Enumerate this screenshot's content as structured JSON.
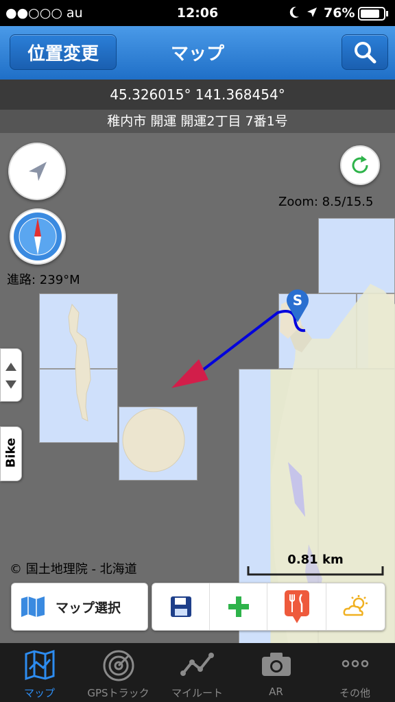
{
  "status_bar": {
    "carrier": "●●○○○ au",
    "time": "12:06",
    "battery": "76%"
  },
  "nav": {
    "left_button": "位置変更",
    "title": "マップ"
  },
  "info": {
    "coordinates": "45.326015° 141.368454°",
    "address": "稚内市 開運 開運2丁目 7番1号"
  },
  "map": {
    "zoom": "Zoom: 8.5/15.5",
    "heading": "進路: 239°M",
    "attribution": "© 国土地理院 - 北海道",
    "scale": "0.81 km",
    "start_marker": "S",
    "bike_tab": "Bike"
  },
  "toolbar": {
    "map_select": "マップ選択"
  },
  "tabs": [
    {
      "label": "マップ"
    },
    {
      "label": "GPSトラック"
    },
    {
      "label": "マイルート"
    },
    {
      "label": "AR"
    },
    {
      "label": "その他"
    }
  ],
  "colors": {
    "active_tab": "#2d8cf0",
    "nav": "#2a7ad3",
    "track": "#0000dd",
    "arrow": "#d21e4a"
  }
}
